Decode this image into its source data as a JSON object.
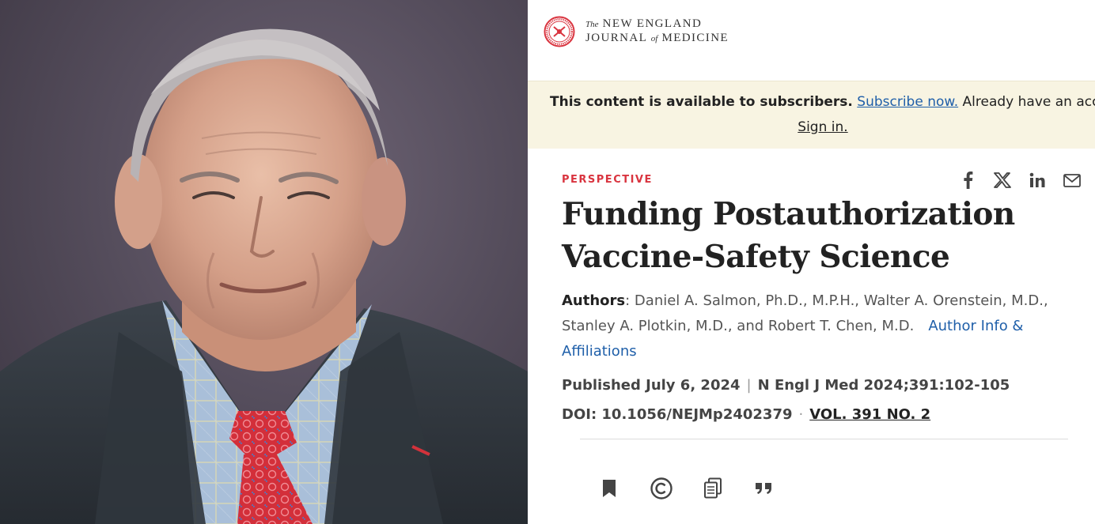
{
  "journal": {
    "name_prefix": "The",
    "name_line1": "NEW ENGLAND",
    "name_line2_a": "JOURNAL",
    "name_line2_of": "of",
    "name_line2_b": "MEDICINE",
    "accent_color": "#d9343f"
  },
  "access_notice": {
    "lead": "This content is available to subscribers.",
    "subscribe_link": "Subscribe now.",
    "account_prompt": "Already have an account?",
    "signin_link": "Sign in."
  },
  "article": {
    "section": "PERSPECTIVE",
    "title": "Funding Postauthorization Vaccine-Safety Science",
    "authors_label": "Authors",
    "authors_sep": ": ",
    "authors_text": "Daniel A. Salmon, Ph.D., M.P.H., Walter A. Orenstein, M.D., Stanley A. Plotkin, M.D., and Robert T. Chen, M.D.",
    "affiliations_link": "Author Info & Affiliations",
    "published": "Published July 6, 2024",
    "pub_sep": "|",
    "citation": "N Engl J Med 2024;391:102-105",
    "doi": "DOI: 10.1056/NEJMp2402379",
    "doi_sep": "·",
    "volume_link": "VOL. 391 NO. 2"
  },
  "share_icons": [
    "facebook-icon",
    "x-icon",
    "linkedin-icon",
    "email-icon"
  ],
  "toolbar_icons": [
    "bookmark-icon",
    "copyright-icon",
    "copy-icon",
    "quote-icon"
  ]
}
